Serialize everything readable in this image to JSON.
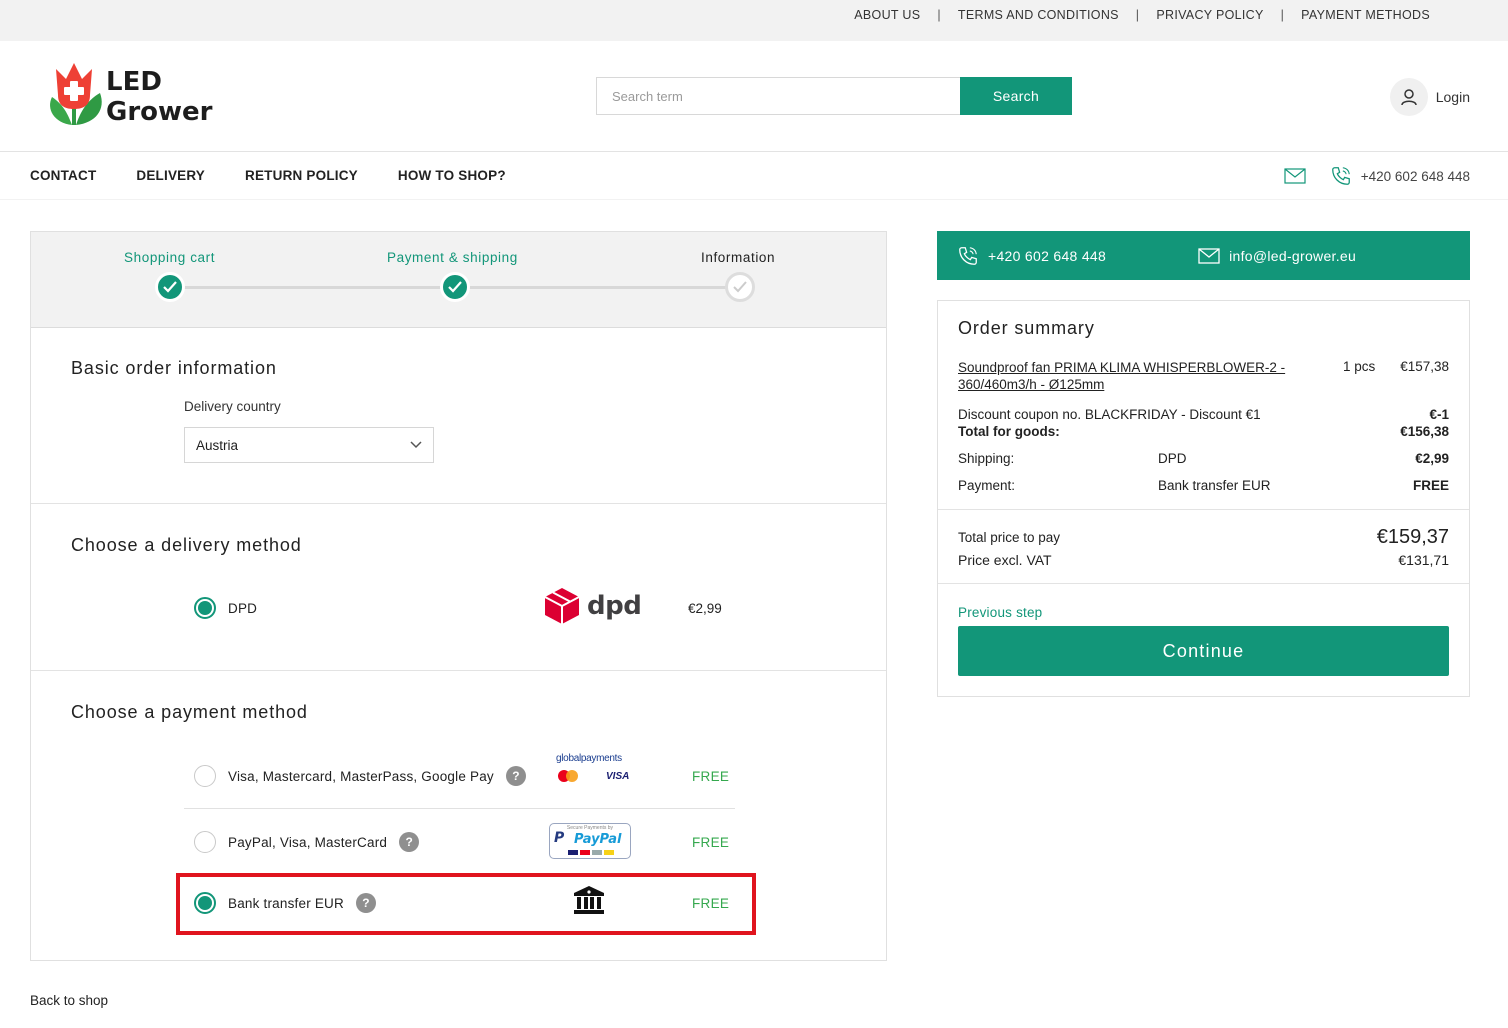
{
  "topbar": {
    "links": [
      "ABOUT US",
      "TERMS AND CONDITIONS",
      "PRIVACY POLICY",
      "PAYMENT METHODS"
    ],
    "separator": "|"
  },
  "header": {
    "logo_line1": "LED",
    "logo_line2": "Grower",
    "search_placeholder": "Search term",
    "search_button": "Search",
    "login": "Login"
  },
  "nav": {
    "links": [
      "CONTACT",
      "DELIVERY",
      "RETURN POLICY",
      "HOW TO SHOP?"
    ],
    "phone": "+420 602 648 448"
  },
  "steps": [
    {
      "label": "Shopping cart",
      "state": "done"
    },
    {
      "label": "Payment & shipping",
      "state": "done"
    },
    {
      "label": "Information",
      "state": "todo"
    }
  ],
  "basic": {
    "title": "Basic order information",
    "country_label": "Delivery country",
    "country_value": "Austria"
  },
  "delivery": {
    "title": "Choose a delivery method",
    "option": {
      "label": "DPD",
      "logo_text": "dpd",
      "price": "€2,99",
      "selected": true
    }
  },
  "payment": {
    "title": "Choose a payment method",
    "options": [
      {
        "label": "Visa, Mastercard, MasterPass, Google Pay",
        "help": "?",
        "logo_top": "globalpayments",
        "logo_card": "VISA",
        "price": "FREE",
        "selected": false
      },
      {
        "label": "PayPal, Visa, MasterCard",
        "help": "?",
        "logo_caption": "Secure Payments by",
        "logo_text": "PayPal",
        "price": "FREE",
        "selected": false
      },
      {
        "label": "Bank transfer EUR",
        "help": "?",
        "price": "FREE",
        "selected": true
      }
    ]
  },
  "back_link": "Back to shop",
  "contactbar": {
    "phone": "+420 602 648 448",
    "email": "info@led-grower.eu"
  },
  "summary": {
    "title": "Order summary",
    "item_name_line1": "Soundproof fan PRIMA KLIMA WHISPERBLOWER-2 -",
    "item_name_line2": "360/460m3/h - Ø125mm",
    "item_qty": "1 pcs",
    "item_price": "€157,38",
    "discount_label": "Discount coupon no. BLACKFRIDAY - Discount €1",
    "discount_value": "€-1",
    "goods_label": "Total for goods:",
    "goods_value": "€156,38",
    "shipping_label": "Shipping:",
    "shipping_method": "DPD",
    "shipping_value": "€2,99",
    "payment_label": "Payment:",
    "payment_method": "Bank transfer EUR",
    "payment_value": "FREE",
    "total_label": "Total price to pay",
    "total_value": "€159,37",
    "excl_label": "Price excl. VAT",
    "excl_value": "€131,71",
    "previous": "Previous step",
    "continue": "Continue"
  },
  "colors": {
    "accent": "#129679",
    "free": "#35a84e",
    "highlight": "#e0141e",
    "dpd_red": "#dc0032"
  }
}
